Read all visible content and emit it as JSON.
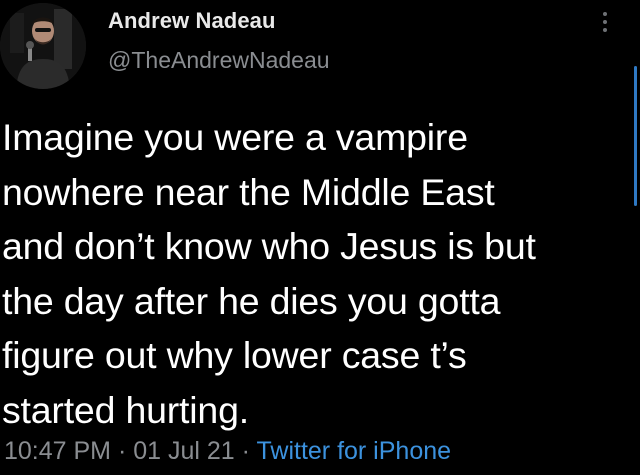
{
  "author": {
    "display_name": "Andrew Nadeau",
    "handle": "@TheAndrewNadeau"
  },
  "tweet": {
    "text": "Imagine you were a vampire\nnowhere near the Middle East\nand don’t know who Jesus is but\nthe day after he dies you gotta\nfigure out why lower case t’s\nstarted hurting."
  },
  "meta": {
    "time": "10:47 PM",
    "separator": "·",
    "date": "01 Jul 21",
    "source": "Twitter for iPhone"
  },
  "icons": {
    "more": "more-vertical-icon"
  },
  "colors": {
    "background": "#000000",
    "text_primary": "#ffffff",
    "text_secondary": "#8a8d91",
    "link": "#3c92de",
    "scroll_indicator": "#2f79c4"
  }
}
